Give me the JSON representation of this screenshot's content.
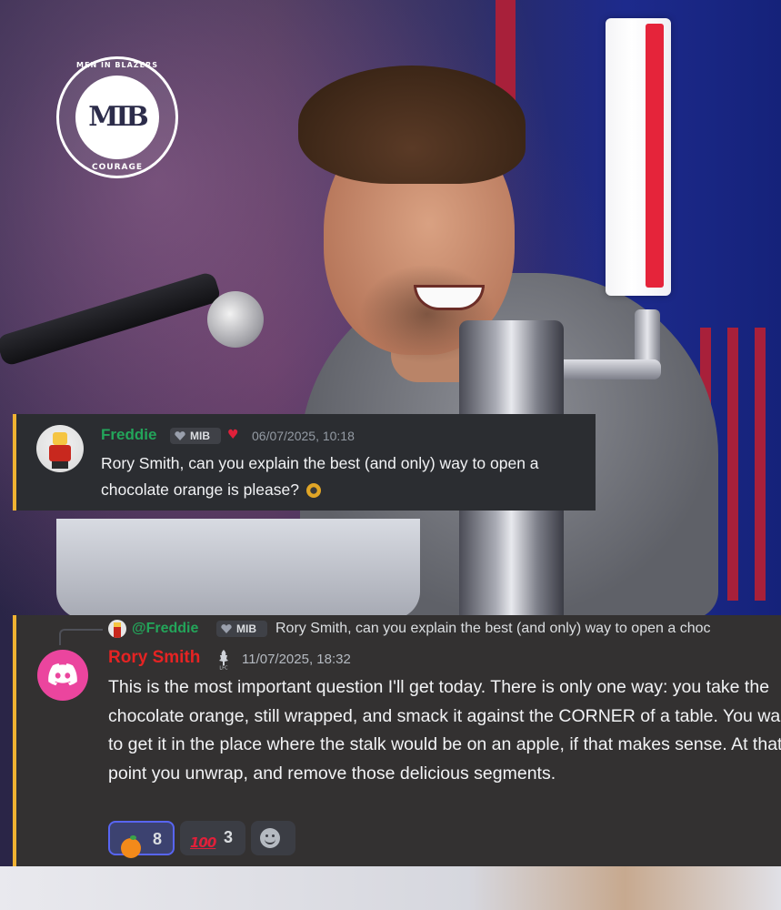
{
  "logo": {
    "top_text": "MEN IN BLAZERS",
    "bottom_text": "COURAGE",
    "mark": "MIB"
  },
  "message1": {
    "author": "Freddie",
    "tag": "MIB",
    "timestamp": "06/07/2025, 10:18",
    "text": "Rory Smith, can you explain the best (and only) way to open a chocolate orange is please?",
    "name_color": "#23a55a"
  },
  "message2": {
    "reply": {
      "mention": "@Freddie",
      "tag": "MIB",
      "preview": "Rory Smith, can you explain the best (and only) way to open a choc"
    },
    "author": "Rory Smith",
    "timestamp": "11/07/2025, 18:32",
    "text": "This is the most important question I'll get today. There is only one way: you take the chocolate orange, still wrapped, and smack it against the CORNER of a table. You want to get it in the place where the stalk would be on an apple, if that makes sense. At that point you unwrap, and remove those delicious segments.",
    "name_color": "#e62323",
    "reactions": [
      {
        "emoji": "tangerine-icon",
        "count": "8",
        "active": true
      },
      {
        "emoji": "hundred-points-icon",
        "count": "3",
        "active": false
      }
    ]
  },
  "colors": {
    "card_bg": "#2b2d31",
    "card_bg_2": "#333131",
    "accent_bar": "#f0b232",
    "discord_avatar": "#eb459e"
  }
}
